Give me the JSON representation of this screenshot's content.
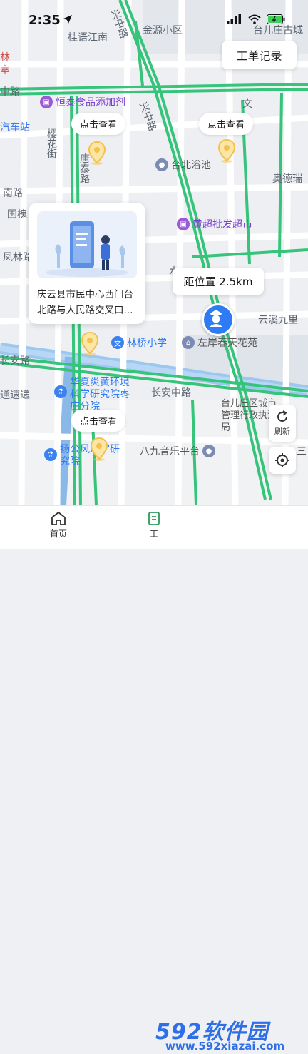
{
  "status_bar": {
    "time": "2:35"
  },
  "map": {
    "road_labels": {
      "guiyu_jiangnan": "桂语江南",
      "jinyuan_xiaoqu": "金源小区",
      "taierzhuang_old_town": "台儿庄古城",
      "xingzhong_road_top": "兴中路",
      "zhong_road": "中路",
      "xingzhong_road_mid": "兴中路",
      "lin_shi": "林",
      "shi": "室",
      "qiche_zhan": "汽车站",
      "ying_hua_jie": "樱花街",
      "tang_tai_road": "唐泰路",
      "nan_road": "南路",
      "guo_huai": "国槐",
      "feng_lin_road": "凤林路",
      "ao_de": "奥德瑞",
      "yunxi_jiuli": "云溪九里",
      "chang_an_road_left": "长安路",
      "tong_da_di": "通速递",
      "changan_middle_road": "长安中路",
      "wen": "文",
      "shui": "水",
      "tai_bei_yu_chi": "台北浴池"
    },
    "pois": {
      "hengtai": "恒泰食品添加剂",
      "huangchao": "黄超批发超市",
      "linqiao": "林桥小学",
      "zuoan": "左岸春天花苑",
      "huaxia": "华夏炎黄环境科学研究院枣庄分院",
      "yanggong": "扬公风水学研究院",
      "bajiu": "八九音乐平台",
      "district_court": "台儿庄区城市管理行政执法局",
      "san": "三"
    }
  },
  "work_order_button": "工单记录",
  "view_bubbles": [
    "点击查看",
    "点击查看",
    "点击查看"
  ],
  "location_card": {
    "text": "庆云县市民中心西门台北路与人民路交叉口..."
  },
  "distance": "距位置 2.5km",
  "refresh_label": "刷新",
  "tabs": {
    "home": "首页",
    "work": "工"
  },
  "watermark": {
    "brand": "592软件园",
    "url": "www.592xiazai.com"
  },
  "colors": {
    "road_green": "#35c47a",
    "accent_blue": "#2f7bf5",
    "pin_yellow": "#f4c54a",
    "water_blue": "#7fb7e6"
  }
}
